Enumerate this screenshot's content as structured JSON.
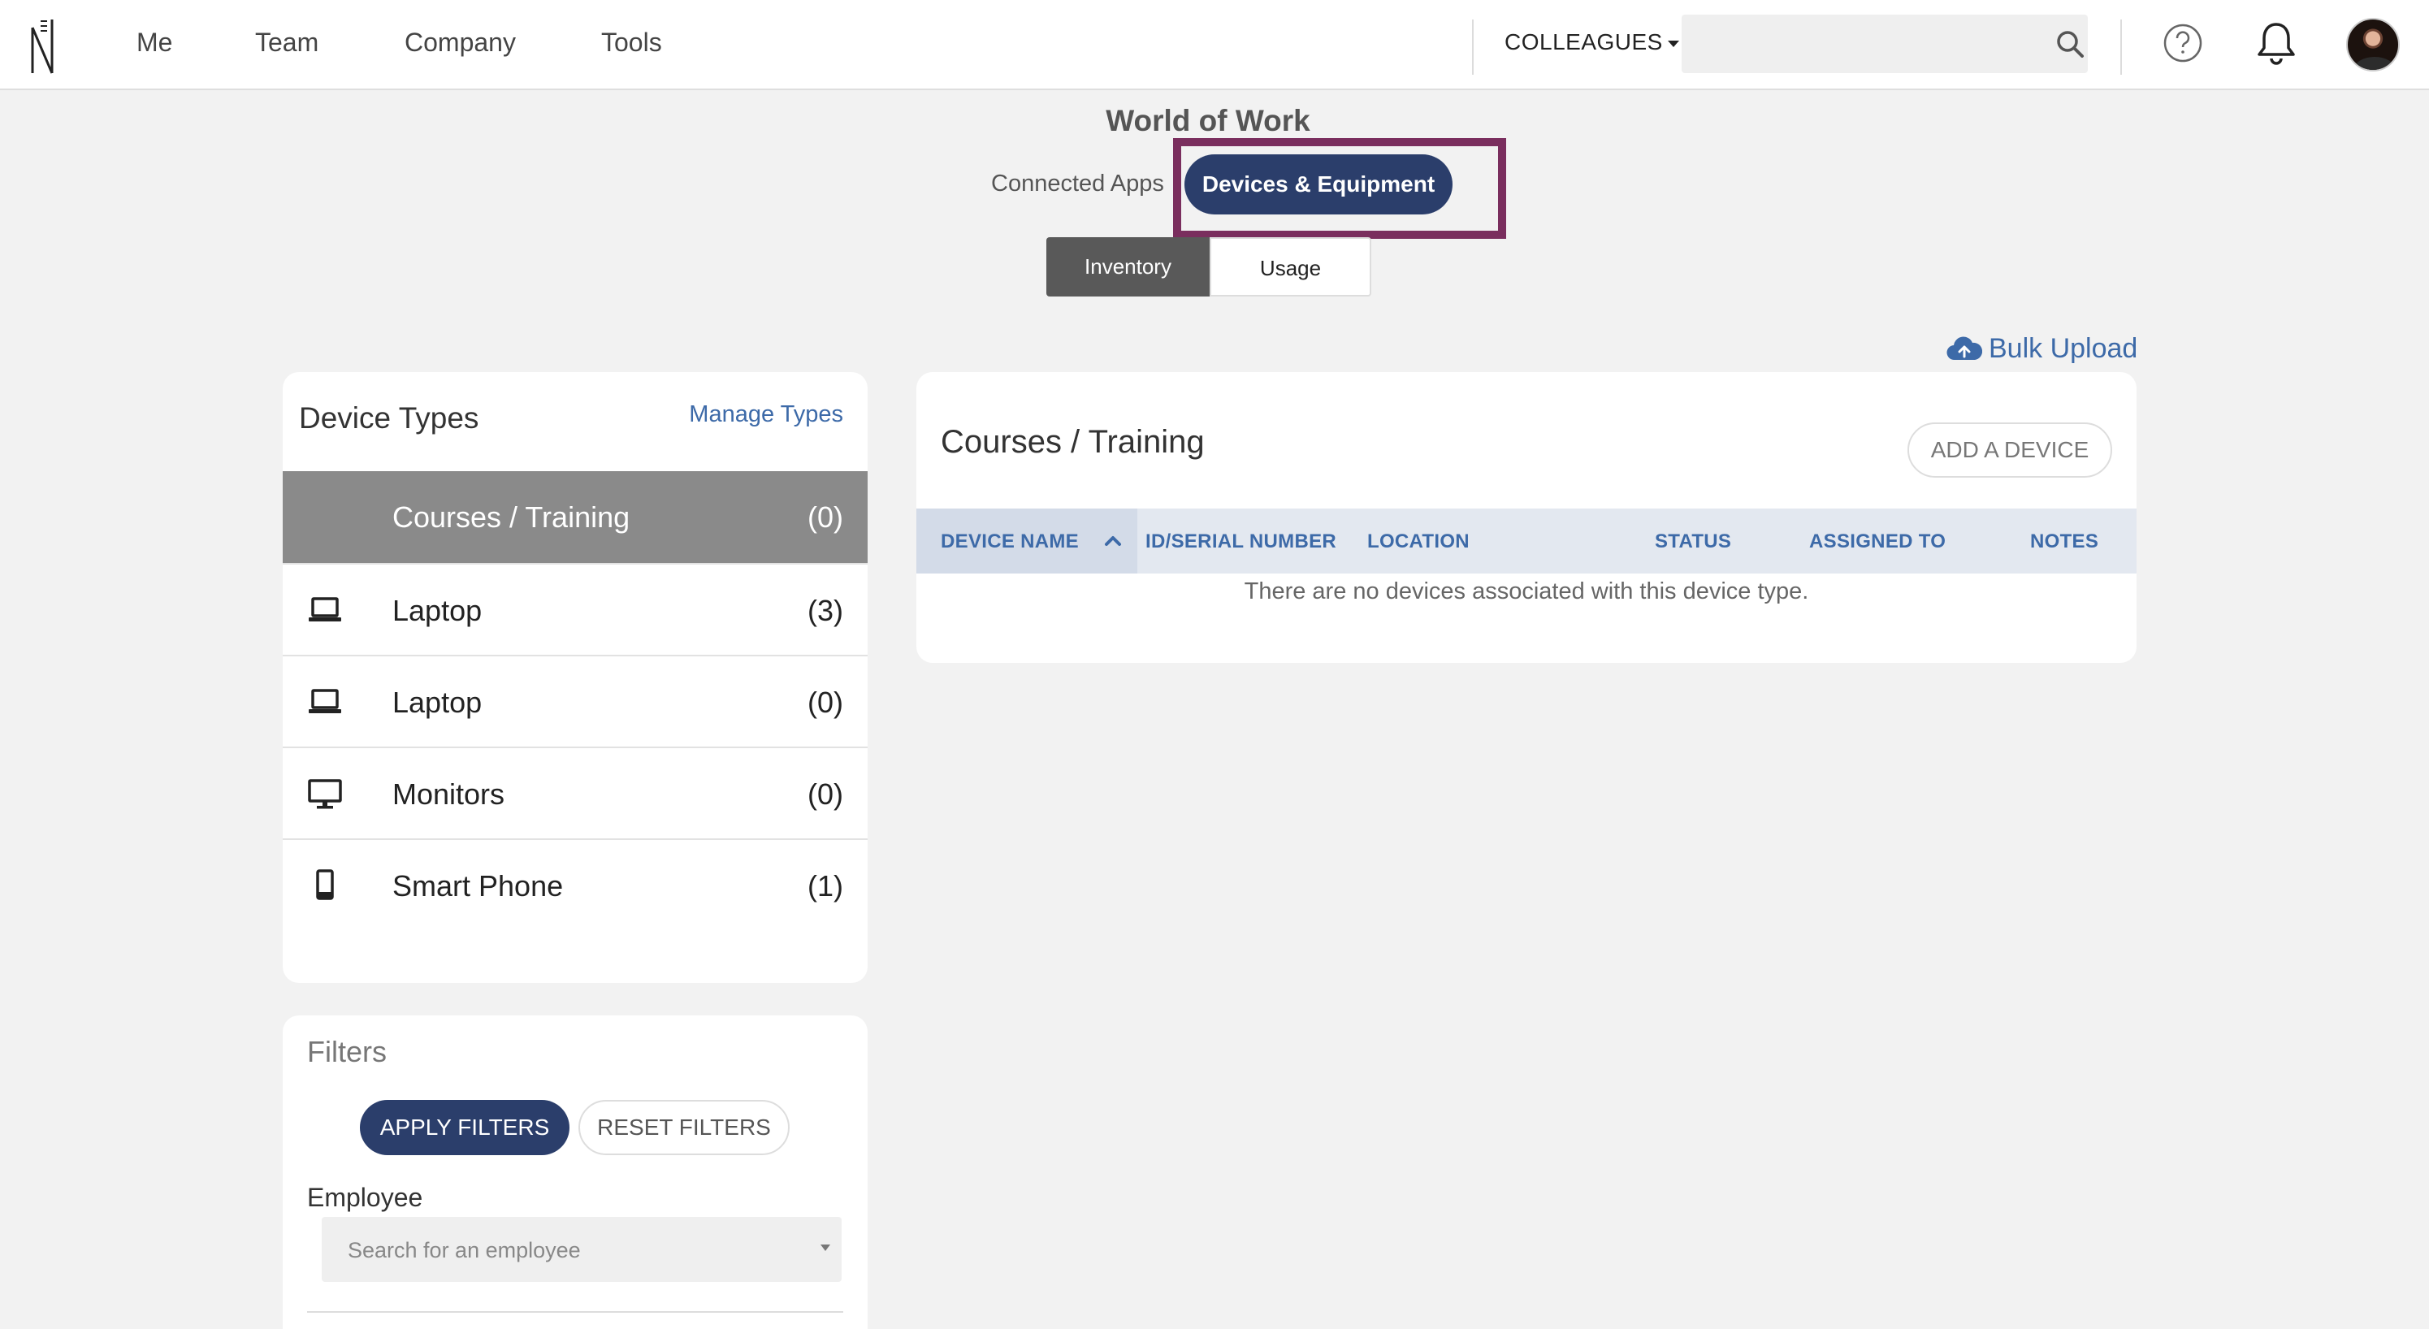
{
  "nav": {
    "items": [
      "Me",
      "Team",
      "Company",
      "Tools"
    ],
    "colleagues_label": "COLLEAGUES",
    "search_placeholder": ""
  },
  "page": {
    "title": "World of Work",
    "tabs": [
      "Connected Apps",
      "Devices & Equipment"
    ],
    "subtabs": [
      "Inventory",
      "Usage"
    ],
    "bulk_upload": "Bulk Upload"
  },
  "device_types": {
    "title": "Device Types",
    "manage_label": "Manage Types",
    "items": [
      {
        "name": "Courses / Training",
        "count": "(0)",
        "icon": "none"
      },
      {
        "name": "Laptop",
        "count": "(3)",
        "icon": "laptop-icon"
      },
      {
        "name": "Laptop",
        "count": "(0)",
        "icon": "laptop-icon"
      },
      {
        "name": "Monitors",
        "count": "(0)",
        "icon": "monitor-icon"
      },
      {
        "name": "Smart Phone",
        "count": "(1)",
        "icon": "smartphone-icon"
      }
    ]
  },
  "filters": {
    "title": "Filters",
    "apply_label": "APPLY FILTERS",
    "reset_label": "RESET FILTERS",
    "employee_label": "Employee",
    "employee_placeholder": "Search for an employee"
  },
  "device_list": {
    "title": "Courses / Training",
    "add_label": "ADD A DEVICE",
    "columns": [
      "DEVICE NAME",
      "ID/SERIAL NUMBER",
      "LOCATION",
      "STATUS",
      "ASSIGNED TO",
      "NOTES"
    ],
    "empty_message": "There are no devices associated with this device type."
  },
  "colors": {
    "primary": "#2b3e6b",
    "link": "#3d6aa8",
    "highlight": "#7a2e5e",
    "selected_row": "#8a8a8a"
  }
}
